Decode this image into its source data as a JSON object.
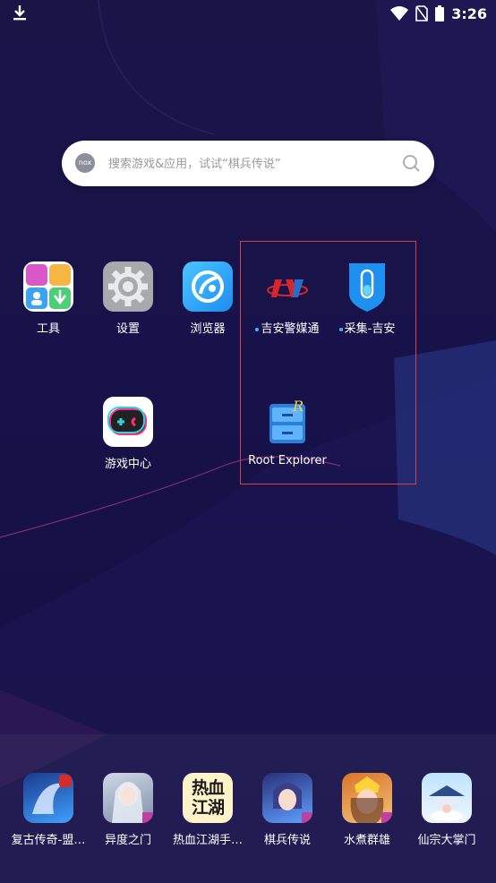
{
  "status_bar": {
    "time": "3:26",
    "left_icon": "download-icon",
    "right_icons": [
      "wifi-icon",
      "no-sim-icon",
      "battery-icon"
    ]
  },
  "search": {
    "logo_text": "nox",
    "placeholder": "搜索游戏&应用，试试“棋兵传说”"
  },
  "apps": [
    {
      "id": "tools",
      "label": "工具",
      "icon": "tools-folder-icon"
    },
    {
      "id": "settings",
      "label": "设置",
      "icon": "gear-icon"
    },
    {
      "id": "browser",
      "label": "浏览器",
      "icon": "browser-icon"
    },
    {
      "id": "jian-media",
      "label": "吉安警媒通",
      "icon": "jian-police-media-icon",
      "new": true
    },
    {
      "id": "collect-jian",
      "label": "采集-吉安",
      "icon": "collect-test-tube-icon",
      "new": true
    },
    {
      "id": "game-center",
      "label": "游戏中心",
      "icon": "game-controller-icon"
    },
    {
      "id": "root-explorer",
      "label": "Root Explorer",
      "icon": "root-explorer-icon"
    }
  ],
  "dock": [
    {
      "id": "fugu",
      "label": "复古传奇-盟…",
      "icon": "dragon-game-icon"
    },
    {
      "id": "yidu",
      "label": "异度之门",
      "icon": "yidu-game-icon"
    },
    {
      "id": "rexue",
      "label": "热血江湖手…",
      "icon": "rexue-jianghu-icon",
      "icon_text": "热血江湖"
    },
    {
      "id": "qibing",
      "label": "棋兵传说",
      "icon": "qibing-game-icon"
    },
    {
      "id": "shuizhu",
      "label": "水煮群雄",
      "icon": "shuizhu-game-icon"
    },
    {
      "id": "xianzong",
      "label": "仙宗大掌门",
      "icon": "xianzong-game-icon"
    }
  ],
  "colors": {
    "background": "#17124a",
    "highlight_border": "#d9403f",
    "new_dot": "#3fb5ff"
  }
}
